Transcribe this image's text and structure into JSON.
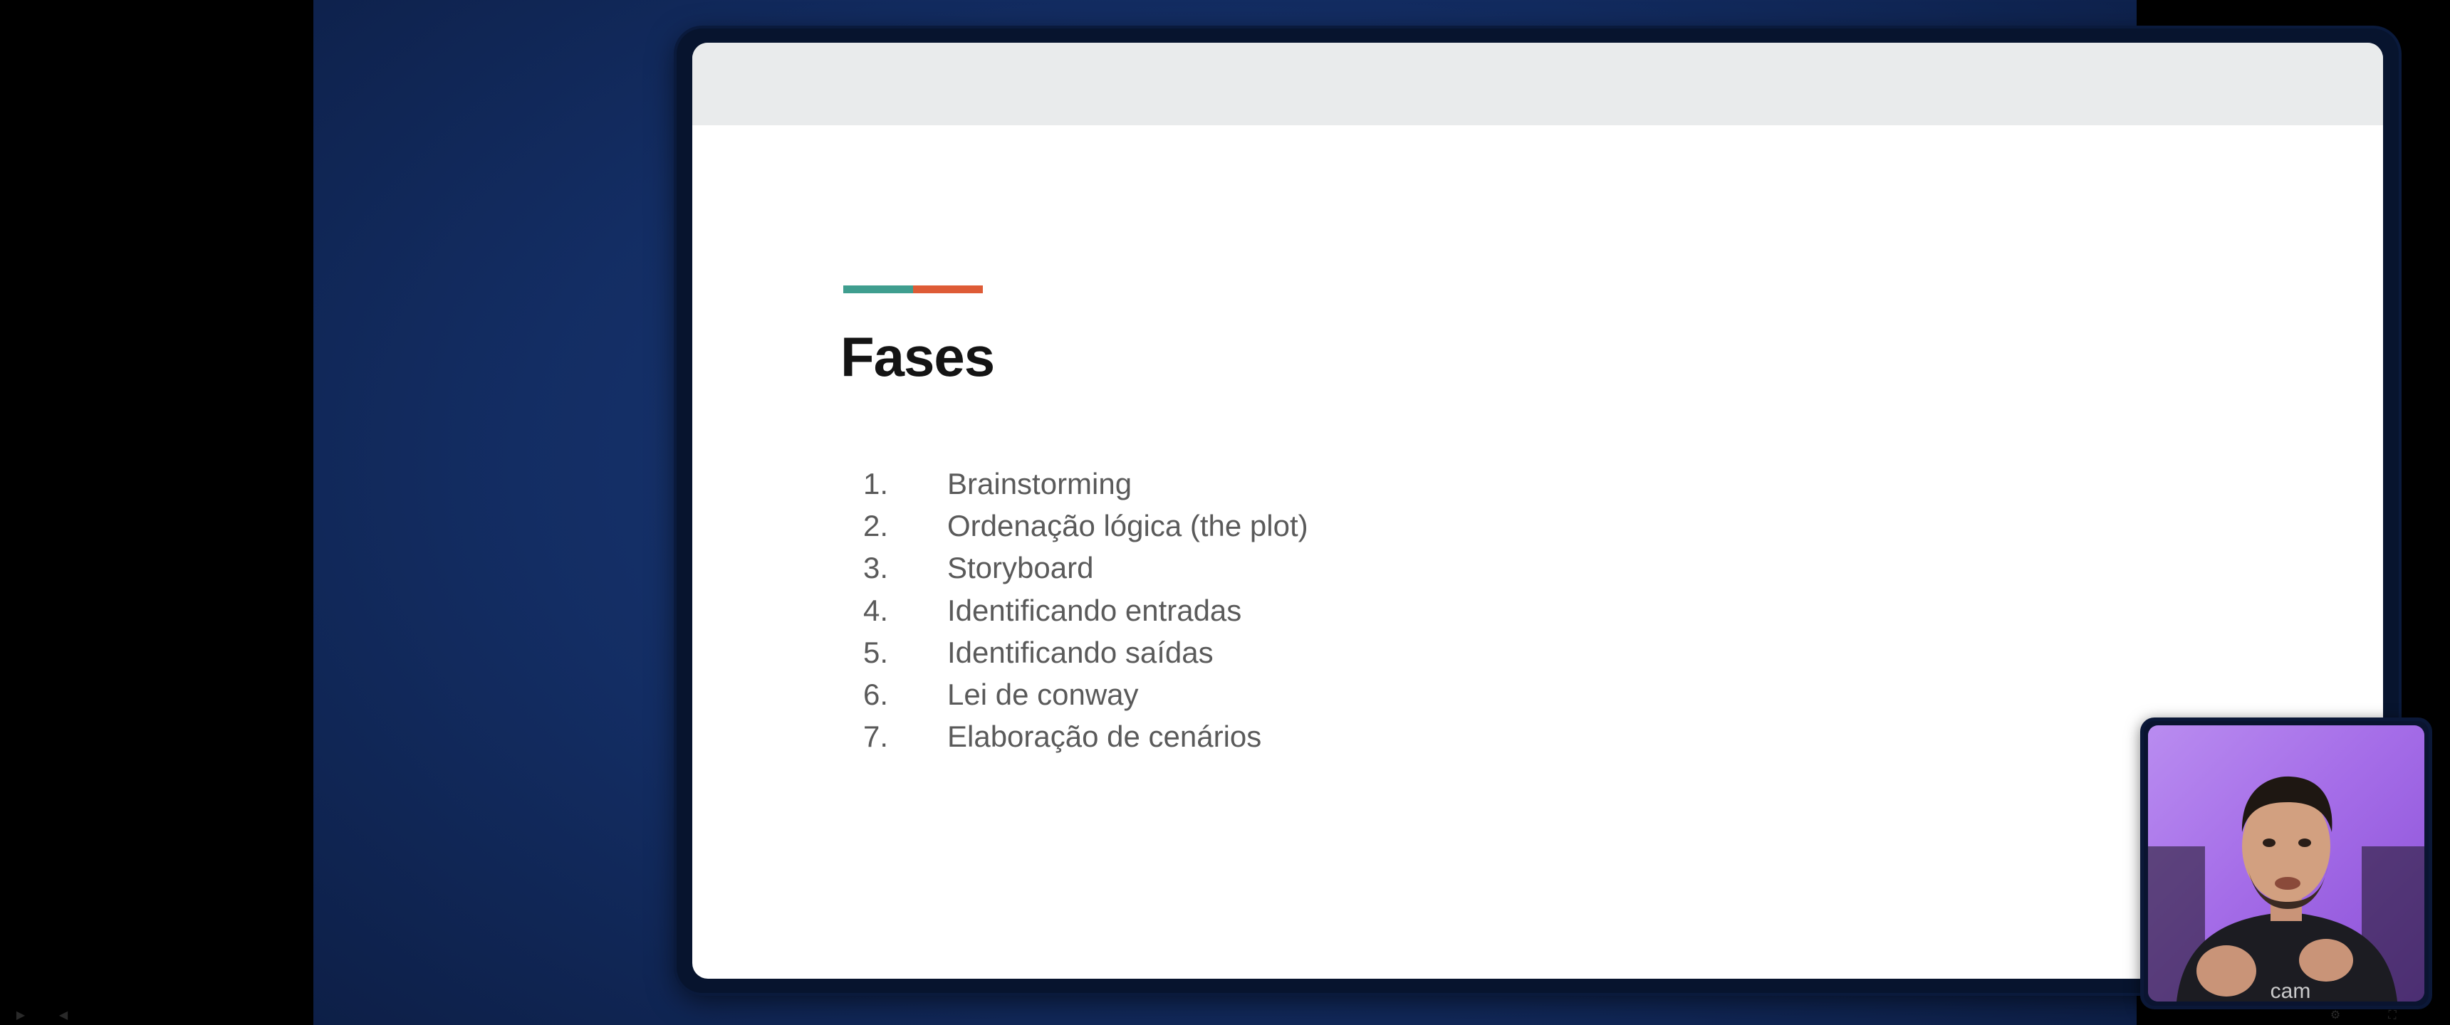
{
  "slide": {
    "title": "Fases",
    "accent_colors": [
      "#3f9e8f",
      "#de5b36"
    ],
    "items": [
      {
        "num": "1.",
        "label": "Brainstorming"
      },
      {
        "num": "2.",
        "label": "Ordenação lógica (the plot)"
      },
      {
        "num": "3.",
        "label": "Storyboard"
      },
      {
        "num": "4.",
        "label": "Identificando entradas"
      },
      {
        "num": "5.",
        "label": "Identificando saídas"
      },
      {
        "num": "6.",
        "label": "Lei de conway"
      },
      {
        "num": "7.",
        "label": "Elaboração de cenários"
      }
    ]
  },
  "webcam": {
    "background": "#a56de8"
  },
  "player_controls": {
    "icons": [
      "play-icon",
      "volume-icon",
      "settings-icon",
      "fullscreen-icon"
    ]
  }
}
